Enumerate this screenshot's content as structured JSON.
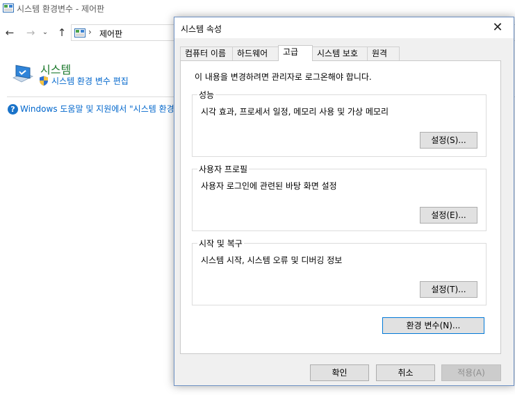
{
  "background_window": {
    "title": "시스템 환경변수 - 제어판",
    "address": {
      "separator": "›",
      "path": "제어판"
    },
    "nav": {
      "back": "←",
      "forward": "→",
      "recent": "⌄",
      "up": "↑"
    },
    "system_title": "시스템",
    "env_link": "시스템 환경 변수 편집",
    "help_icon_glyph": "?",
    "help_link": "Windows 도움말 및 지원에서 \"시스템 환경"
  },
  "dialog": {
    "title": "시스템 속성",
    "close_glyph": "✕",
    "tabs": [
      {
        "label": "컴퓨터 이름"
      },
      {
        "label": "하드웨어"
      },
      {
        "label": "고급"
      },
      {
        "label": "시스템 보호"
      },
      {
        "label": "원격"
      }
    ],
    "active_tab": "고급",
    "admin_note": "이 내용을 변경하려면 관리자로 로그온해야 합니다.",
    "groups": {
      "performance": {
        "label": "성능",
        "description": "시각 효과, 프로세서 일정, 메모리 사용 및 가상 메모리",
        "button": "설정(S)..."
      },
      "profiles": {
        "label": "사용자 프로필",
        "description": "사용자 로그인에 관련된 바탕 화면 설정",
        "button": "설정(E)..."
      },
      "startup": {
        "label": "시작 및 복구",
        "description": "시스템 시작, 시스템 오류 및 디버깅 정보",
        "button": "설정(T)..."
      }
    },
    "env_vars_button": "환경 변수(N)...",
    "ok_button": "확인",
    "cancel_button": "취소",
    "apply_button": "적용(A)"
  },
  "colors": {
    "accent": "#0078d7",
    "link": "#0066cc",
    "system_title": "#1e7a2e",
    "dialog_border": "#6b8fc2"
  },
  "icons": [
    "control-panel-icon",
    "system-computer-icon",
    "uac-shield-icon",
    "help-icon",
    "close-icon"
  ]
}
